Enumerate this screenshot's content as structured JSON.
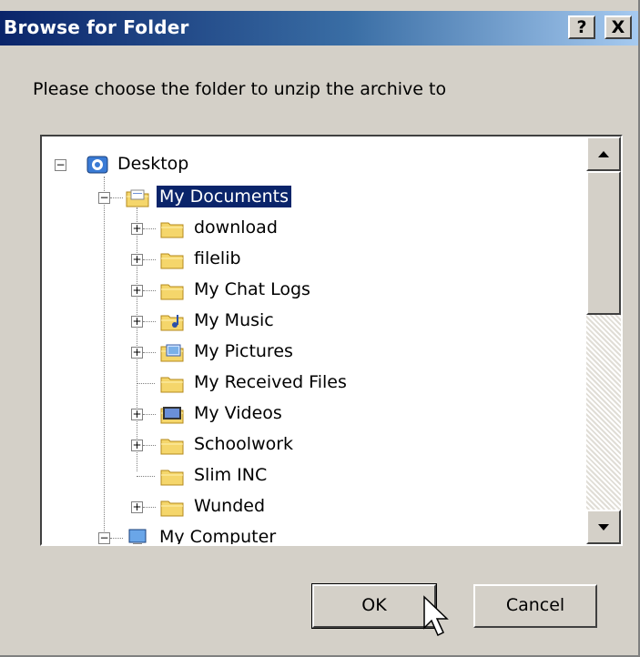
{
  "window": {
    "title": "Browse for Folder",
    "help_label": "?",
    "close_label": "X"
  },
  "prompt": "Please choose the folder to unzip the archive to",
  "tree": {
    "items": [
      {
        "label": "Desktop",
        "icon": "desktop-icon",
        "expander": "minus"
      },
      {
        "label": "My Documents",
        "icon": "my-documents-icon",
        "expander": "minus",
        "selected": true
      },
      {
        "label": "download",
        "icon": "folder-icon",
        "expander": "plus"
      },
      {
        "label": "filelib",
        "icon": "folder-icon",
        "expander": "plus"
      },
      {
        "label": "My Chat Logs",
        "icon": "folder-icon",
        "expander": "plus"
      },
      {
        "label": "My Music",
        "icon": "music-folder-icon",
        "expander": "plus"
      },
      {
        "label": "My Pictures",
        "icon": "pictures-folder-icon",
        "expander": "plus"
      },
      {
        "label": "My Received Files",
        "icon": "folder-icon",
        "expander": "none"
      },
      {
        "label": "My Videos",
        "icon": "videos-folder-icon",
        "expander": "plus"
      },
      {
        "label": "Schoolwork",
        "icon": "folder-icon",
        "expander": "plus"
      },
      {
        "label": "Slim INC",
        "icon": "folder-icon",
        "expander": "none"
      },
      {
        "label": "Wunded",
        "icon": "folder-icon",
        "expander": "plus"
      },
      {
        "label": "My Computer",
        "icon": "computer-icon",
        "expander": "minus"
      }
    ]
  },
  "buttons": {
    "ok": "OK",
    "cancel": "Cancel"
  },
  "colors": {
    "title_bar_start": "#0a246a",
    "title_bar_end": "#a6caf0",
    "selection": "#0a246a",
    "face": "#d4d0c8",
    "folder": "#f5d66b"
  }
}
